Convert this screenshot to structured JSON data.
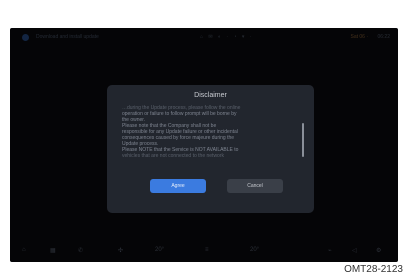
{
  "statusbar": {
    "title": "Download and install update",
    "icons": "⌂ ✉ ◐ · ◔ ▾ ·",
    "right": "Sat 06 ·",
    "time": "06:22"
  },
  "dialog": {
    "title": "Disclaimer",
    "body_lines": [
      "operation or failure to follow prompt will be borne by",
      "the owner.",
      "Please note that the Company shall not be",
      "responsible for any Update failure or other incidental",
      "consequences caused by force majeure during the",
      "Update process.",
      "Please NOTE that the Service is NOT AVAILABLE to"
    ],
    "faint_top": "…during the Update process, please follow the online",
    "faint_bottom": "vehicles that are not connected to the network",
    "agree_label": "Agree",
    "cancel_label": "Cancel"
  },
  "bottombar": {
    "left_temp": "20°",
    "right_temp": "20°"
  },
  "caption": "OMT28-2123"
}
